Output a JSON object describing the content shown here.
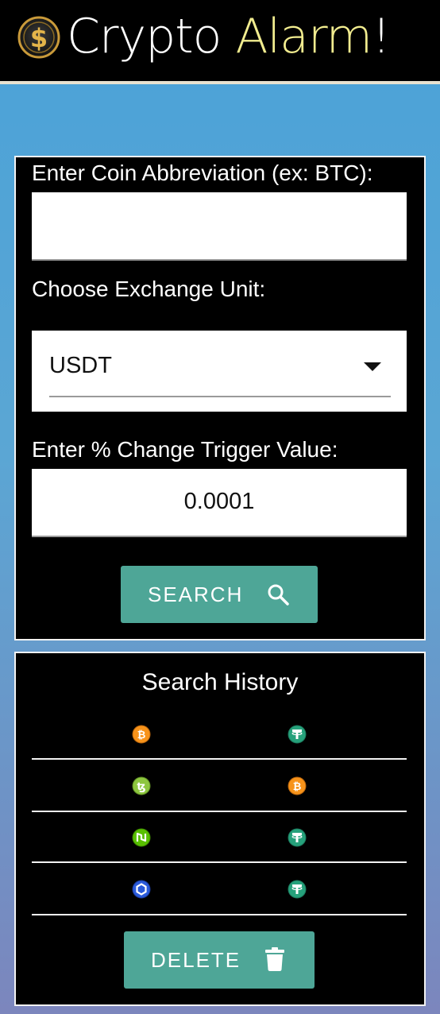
{
  "header": {
    "title_word1": "Crypto",
    "title_word2": "Alarm",
    "title_suffix": "!",
    "logo_icon": "dollar-coin-icon"
  },
  "search": {
    "coin_label": "Enter Coin Abbreviation (ex: BTC):",
    "coin_value": "",
    "exchange_label": "Choose Exchange Unit:",
    "exchange_selected": "USDT",
    "trigger_label": "Enter % Change Trigger Value:",
    "trigger_value": "0.0001",
    "search_button": "SEARCH",
    "search_icon": "magnifier-icon"
  },
  "history": {
    "title": "Search History",
    "rows": [
      {
        "coin": "bitcoin-icon",
        "unit": "tether-icon"
      },
      {
        "coin": "tezos-icon",
        "unit": "bitcoin-icon"
      },
      {
        "coin": "neo-icon",
        "unit": "tether-icon"
      },
      {
        "coin": "chainlink-icon",
        "unit": "tether-icon"
      }
    ],
    "delete_button": "DELETE",
    "delete_icon": "trash-icon"
  },
  "colors": {
    "accent": "#4ea697",
    "title_highlight": "#f1ec8f",
    "background_top": "#4aa2d8",
    "background_bottom": "#7c86bd"
  }
}
